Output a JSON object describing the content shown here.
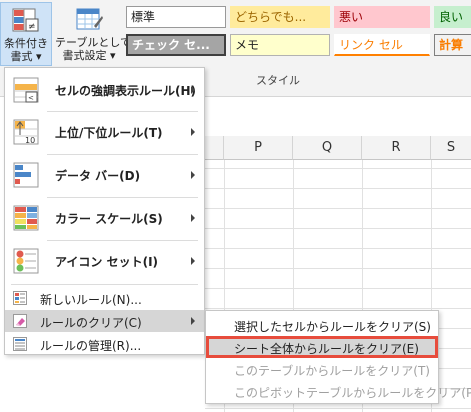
{
  "ribbon": {
    "conditional_formatting": {
      "line1": "条件付き",
      "line2": "書式 ▾"
    },
    "format_as_table": {
      "line1": "テーブルとして",
      "line2": "書式設定 ▾"
    },
    "cell_styles": [
      "標準",
      "どちらでも...",
      "悪い",
      "良い",
      "チェック セ...",
      "メモ",
      "リンク セル",
      "計算"
    ],
    "group_label": "スタイル"
  },
  "columns": [
    "P",
    "Q",
    "R",
    "S"
  ],
  "menu": {
    "items": [
      {
        "label": "セルの強調表示ルール(H)",
        "icon": "highlight-cells-rules-icon",
        "has_submenu": true
      },
      {
        "label": "上位/下位ルール(T)",
        "icon": "top-bottom-rules-icon",
        "has_submenu": true
      },
      {
        "label": "データ バー(D)",
        "icon": "data-bars-icon",
        "has_submenu": true
      },
      {
        "label": "カラー スケール(S)",
        "icon": "color-scales-icon",
        "has_submenu": true
      },
      {
        "label": "アイコン セット(I)",
        "icon": "icon-sets-icon",
        "has_submenu": true
      },
      {
        "label": "新しいルール(N)...",
        "icon": "new-rule-icon",
        "has_submenu": false
      },
      {
        "label": "ルールのクリア(C)",
        "icon": "clear-rules-icon",
        "has_submenu": true,
        "highlighted": true
      },
      {
        "label": "ルールの管理(R)...",
        "icon": "manage-rules-icon",
        "has_submenu": false
      }
    ]
  },
  "submenu": {
    "items": [
      {
        "label": "選択したセルからルールをクリア(S)",
        "enabled": true
      },
      {
        "label": "シート全体からルールをクリア(E)",
        "enabled": true,
        "selected": true
      },
      {
        "label": "このテーブルからルールをクリア(T)",
        "enabled": false
      },
      {
        "label": "このピボットテーブルからルールをクリア(P)",
        "enabled": false
      }
    ]
  },
  "colors": {
    "highlight_box": "#e74c3c",
    "menu_hover": "#d6d6d6",
    "ribbon_active": "#cfe3f7"
  }
}
